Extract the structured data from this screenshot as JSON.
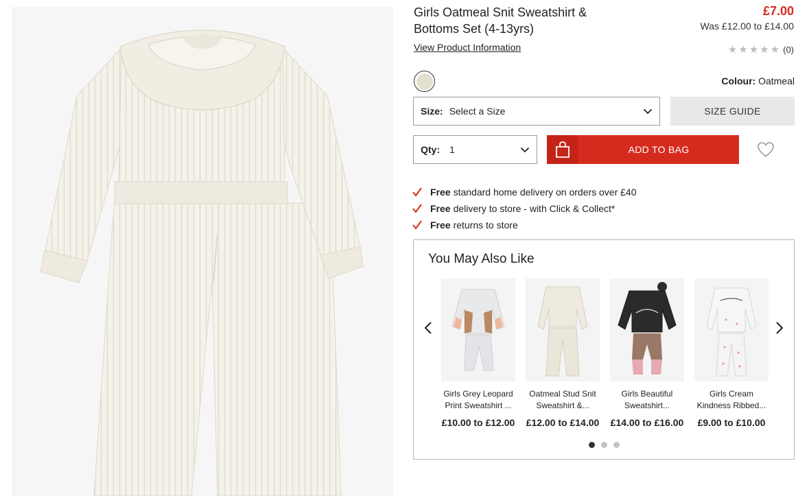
{
  "product": {
    "title_line1": "Girls Oatmeal Snit Sweatshirt &",
    "title_line2": "Bottoms Set (4-13yrs)",
    "price": "£7.00",
    "was_price": "Was £12.00 to £14.00",
    "view_info_label": "View Product Information",
    "rating_count": "(0)",
    "rating_value": 0,
    "rating_max": 5,
    "colour_label": "Colour:",
    "colour_value": "Oatmeal",
    "swatch_color": "#e4e0d0"
  },
  "size": {
    "label": "Size:",
    "value": "Select a Size",
    "guide_label": "SIZE GUIDE"
  },
  "qty": {
    "label": "Qty:",
    "value": "1"
  },
  "cart": {
    "add_label": "ADD TO BAG"
  },
  "benefits": [
    {
      "bold": "Free",
      "text": "standard home delivery on orders over £40"
    },
    {
      "bold": "Free",
      "text": "delivery to store - with Click & Collect*"
    },
    {
      "bold": "Free",
      "text": "returns to store"
    }
  ],
  "recommendations": {
    "title": "You May Also Like",
    "items": [
      {
        "name1": "Girls Grey Leopard",
        "name2": "Print Sweatshirt ...",
        "price": "£10.00 to £12.00"
      },
      {
        "name1": "Oatmeal Stud Snit",
        "name2": "Sweatshirt &...",
        "price": "£12.00 to £14.00"
      },
      {
        "name1": "Girls Beautiful",
        "name2": "Sweatshirt...",
        "price": "£14.00 to £16.00"
      },
      {
        "name1": "Girls Cream",
        "name2": "Kindness Ribbed...",
        "price": "£9.00 to £10.00"
      }
    ],
    "pages": 3,
    "active_page": 1
  },
  "colors": {
    "accent": "#d52b1e",
    "star_empty": "#bdbdbd"
  }
}
